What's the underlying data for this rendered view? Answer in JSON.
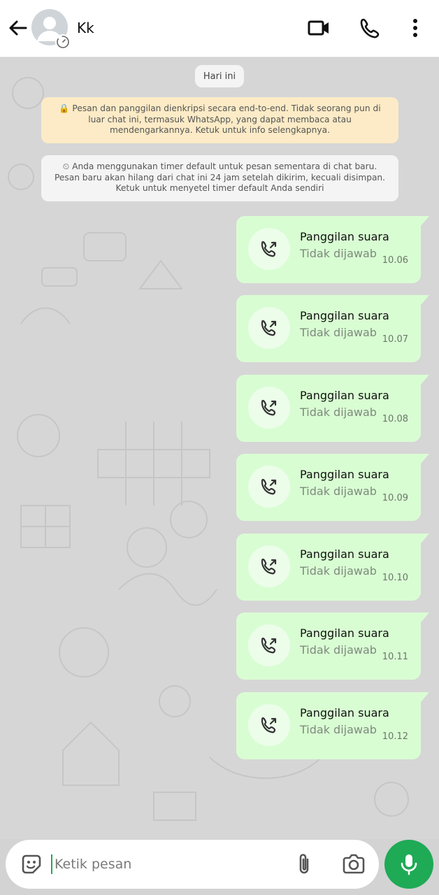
{
  "header": {
    "contact_name": "Kk",
    "icons": [
      "back-arrow-icon",
      "avatar",
      "timer-icon",
      "video-call-icon",
      "voice-call-icon",
      "more-options-icon"
    ]
  },
  "chat": {
    "date_chip": "Hari ini",
    "encryption_notice": "🔒 Pesan dan panggilan dienkripsi secara end-to-end. Tidak seorang pun di luar chat ini, termasuk WhatsApp, yang dapat membaca atau mendengarkannya. Ketuk untuk info selengkapnya.",
    "timer_notice": "⏲ Anda menggunakan timer default untuk pesan sementara di chat baru. Pesan baru akan hilang dari chat ini 24 jam setelah dikirim, kecuali disimpan. Ketuk untuk menyetel timer default Anda sendiri",
    "calls": [
      {
        "title": "Panggilan suara",
        "status": "Tidak dijawab",
        "time": "10.06"
      },
      {
        "title": "Panggilan suara",
        "status": "Tidak dijawab",
        "time": "10.07"
      },
      {
        "title": "Panggilan suara",
        "status": "Tidak dijawab",
        "time": "10.08"
      },
      {
        "title": "Panggilan suara",
        "status": "Tidak dijawab",
        "time": "10.09"
      },
      {
        "title": "Panggilan suara",
        "status": "Tidak dijawab",
        "time": "10.10"
      },
      {
        "title": "Panggilan suara",
        "status": "Tidak dijawab",
        "time": "10.11"
      },
      {
        "title": "Panggilan suara",
        "status": "Tidak dijawab",
        "time": "10.12"
      }
    ]
  },
  "composer": {
    "placeholder": "Ketik pesan",
    "icons": [
      "sticker-icon",
      "attach-icon",
      "camera-icon",
      "mic-icon"
    ]
  },
  "colors": {
    "accent": "#1faa56",
    "outgoing_bubble": "#d9fdd3",
    "encryption_bg": "#fcebc6",
    "chat_bg": "#d6d6d6"
  }
}
